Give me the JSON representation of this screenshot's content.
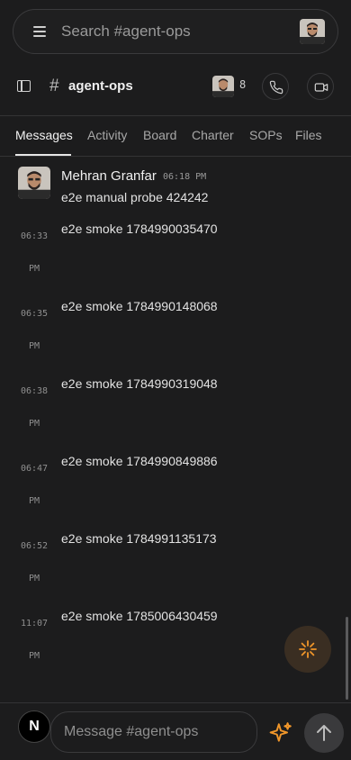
{
  "search": {
    "placeholder": "Search #agent-ops"
  },
  "channel": {
    "hash": "#",
    "name": "agent-ops",
    "member_count": "8"
  },
  "tabs": [
    {
      "label": "Messages",
      "active": true
    },
    {
      "label": "Activity"
    },
    {
      "label": "Board"
    },
    {
      "label": "Charter"
    },
    {
      "label": "SOPs"
    },
    {
      "label": "Files"
    }
  ],
  "messages": {
    "first": {
      "author": "Mehran Granfar",
      "time": "06:18 PM",
      "text": "e2e manual probe 424242"
    },
    "items": [
      {
        "time_hm": "06:33",
        "time_ampm": "PM",
        "text": "e2e smoke 1784990035470"
      },
      {
        "time_hm": "06:35",
        "time_ampm": "PM",
        "text": "e2e smoke 1784990148068"
      },
      {
        "time_hm": "06:38",
        "time_ampm": "PM",
        "text": "e2e smoke 1784990319048"
      },
      {
        "time_hm": "06:47",
        "time_ampm": "PM",
        "text": "e2e smoke 1784990849886"
      },
      {
        "time_hm": "06:52",
        "time_ampm": "PM",
        "text": "e2e smoke 1784991135173"
      },
      {
        "time_hm": "11:07",
        "time_ampm": "PM",
        "text": "e2e smoke 1785006430459"
      }
    ]
  },
  "composer": {
    "user_initial": "N",
    "placeholder": "Message #agent-ops"
  },
  "colors": {
    "background": "#1c1c1d",
    "accent_orange": "#f0962a",
    "border": "#3a3a3c"
  },
  "icons": {
    "menu": "hamburger-icon",
    "sidebar": "sidebar-toggle-icon",
    "phone": "phone-icon",
    "video": "video-icon",
    "fab": "asterisk-spark-icon",
    "ai": "sparkle-icon",
    "send": "arrow-up-icon"
  }
}
